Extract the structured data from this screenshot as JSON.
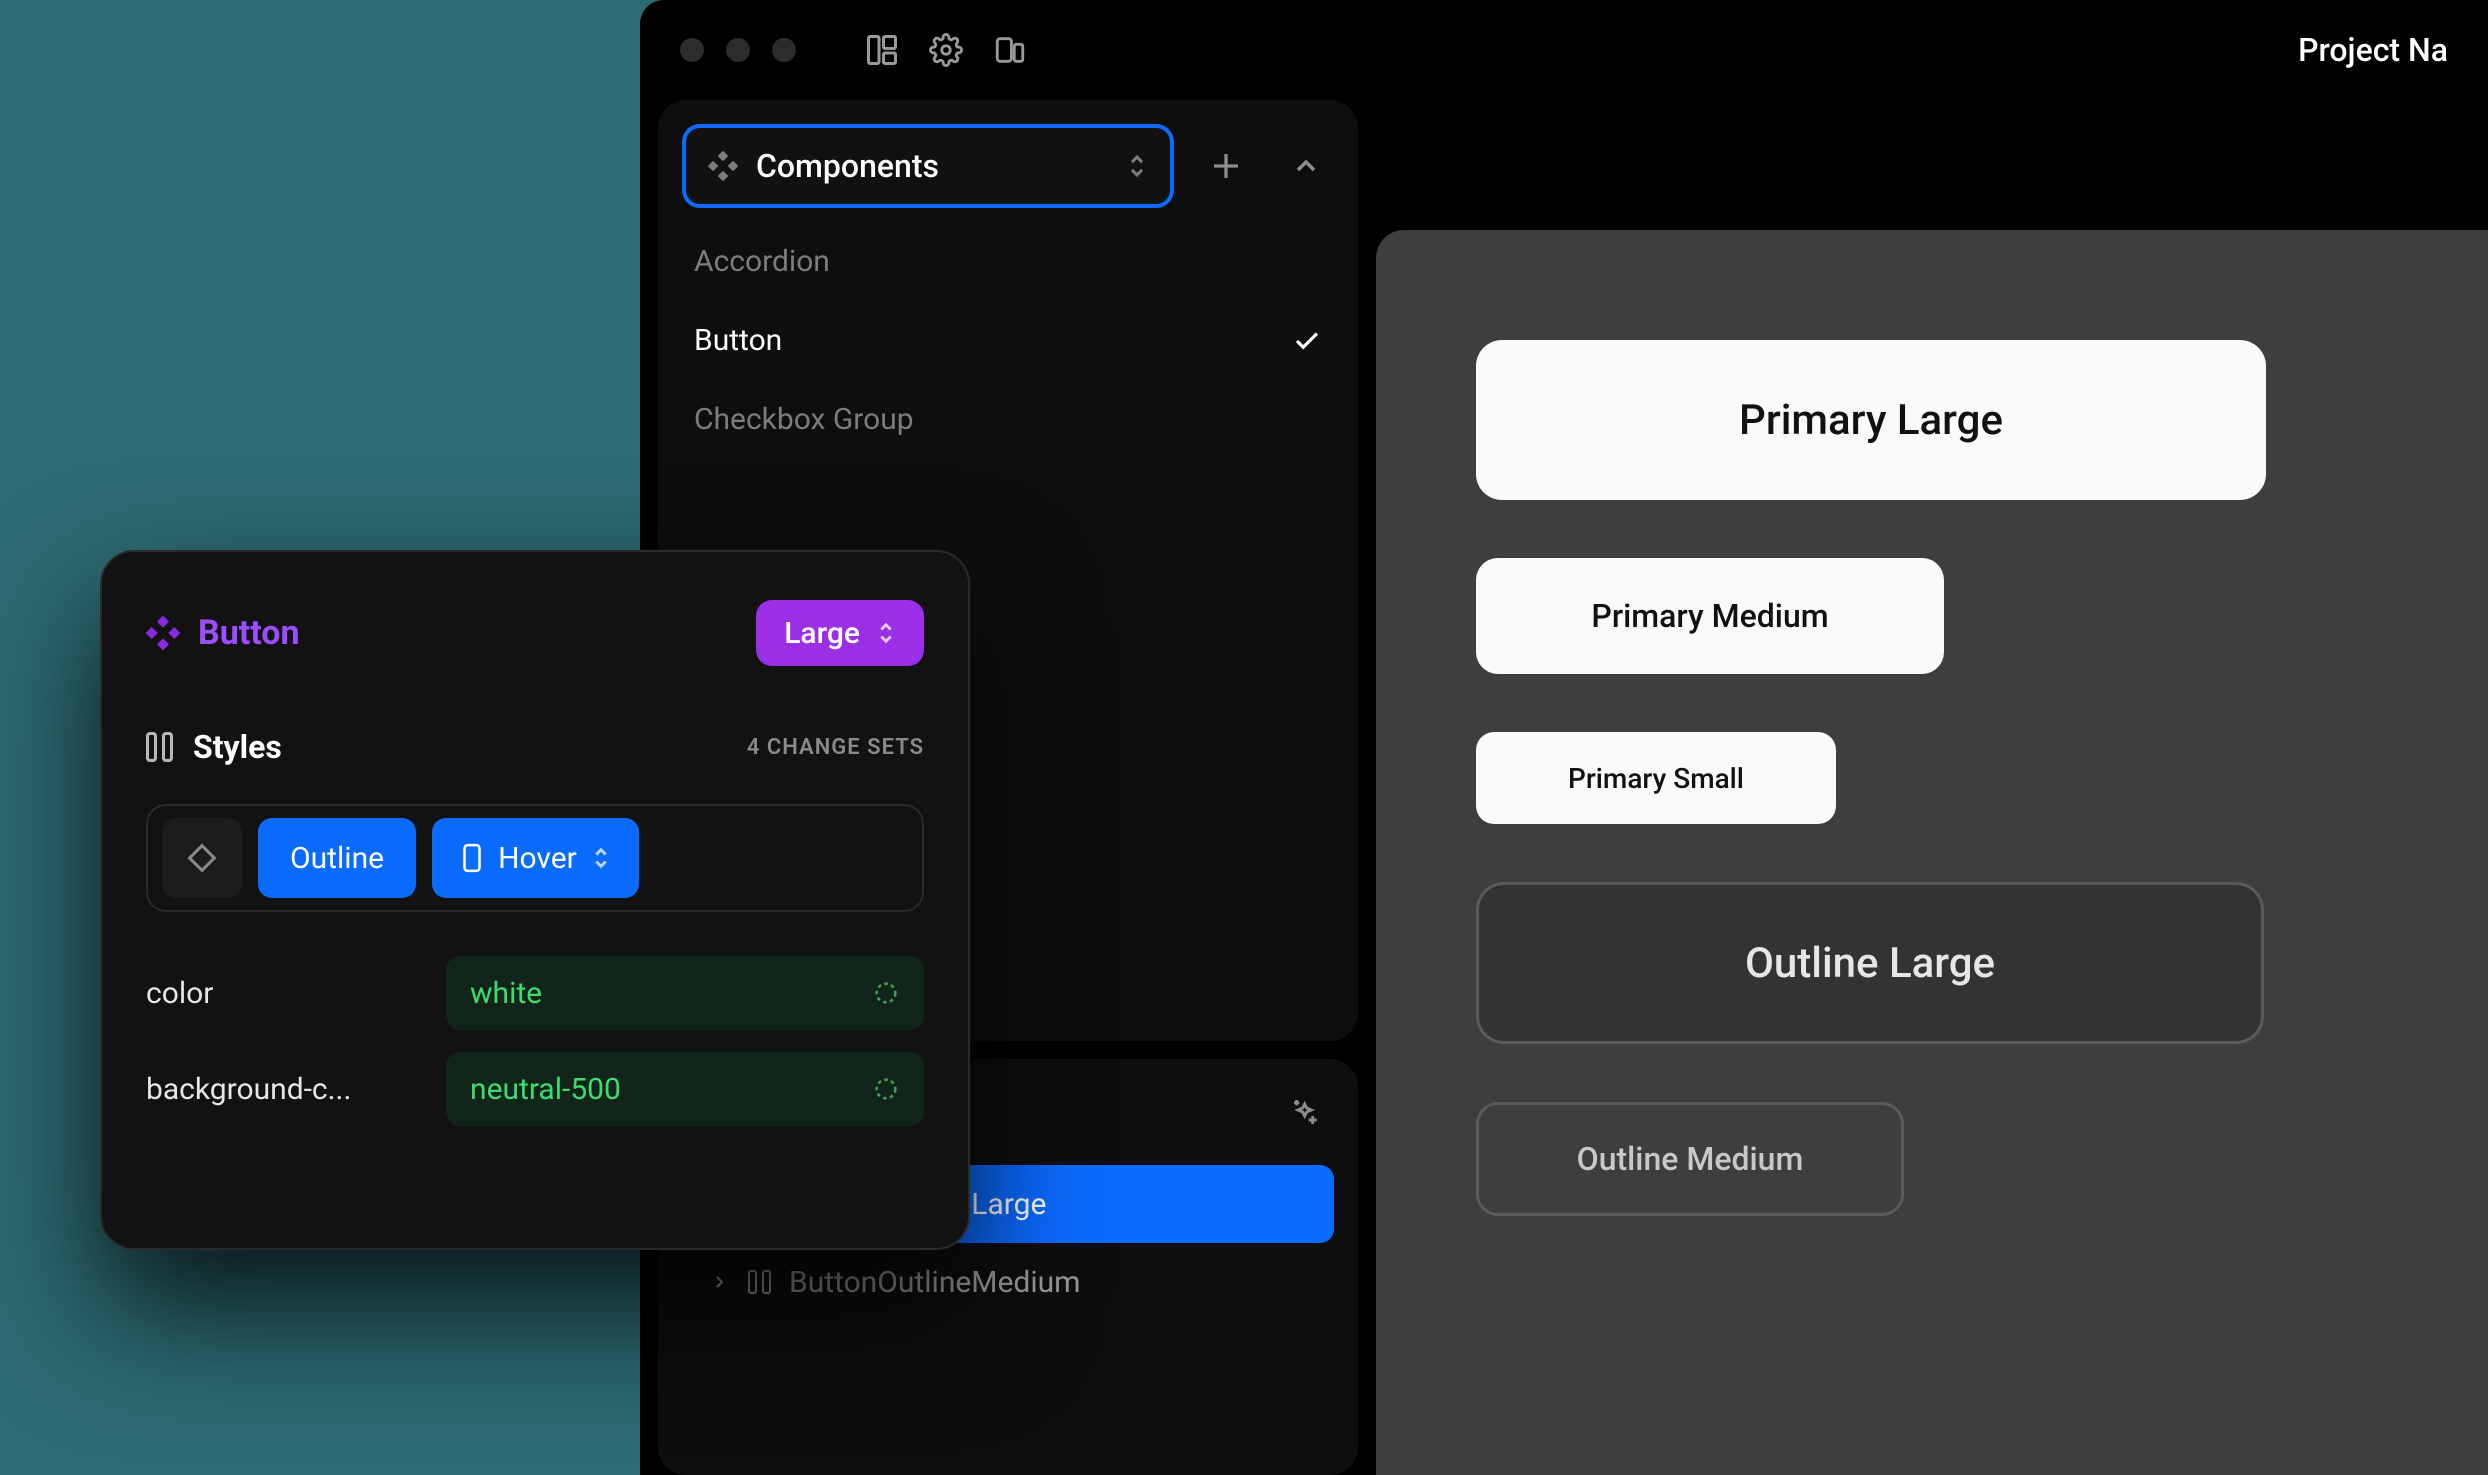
{
  "titlebar": {
    "project_label": "Project Na"
  },
  "sidebar": {
    "selector_label": "Components",
    "items": [
      {
        "label": "Accordion",
        "selected": false
      },
      {
        "label": "Button",
        "selected": true
      },
      {
        "label": "Checkbox Group",
        "selected": false
      }
    ]
  },
  "tree": {
    "rows": [
      {
        "label": "ButtonOutlineLarge",
        "selected": true
      },
      {
        "label": "ButtonOutlineMedium",
        "selected": false
      }
    ]
  },
  "canvas": {
    "buttons": {
      "primary_large": "Primary Large",
      "primary_medium": "Primary Medium",
      "primary_small": "Primary Small",
      "outline_large": "Outline Large",
      "outline_medium": "Outline Medium"
    }
  },
  "inspector": {
    "title": "Button",
    "size_chip": "Large",
    "styles_heading": "Styles",
    "changesets": "4 CHANGE SETS",
    "segmented": {
      "variant": "Outline",
      "state": "Hover"
    },
    "props": [
      {
        "label": "color",
        "value": "white"
      },
      {
        "label": "background-c...",
        "value": "neutral-500"
      }
    ]
  }
}
